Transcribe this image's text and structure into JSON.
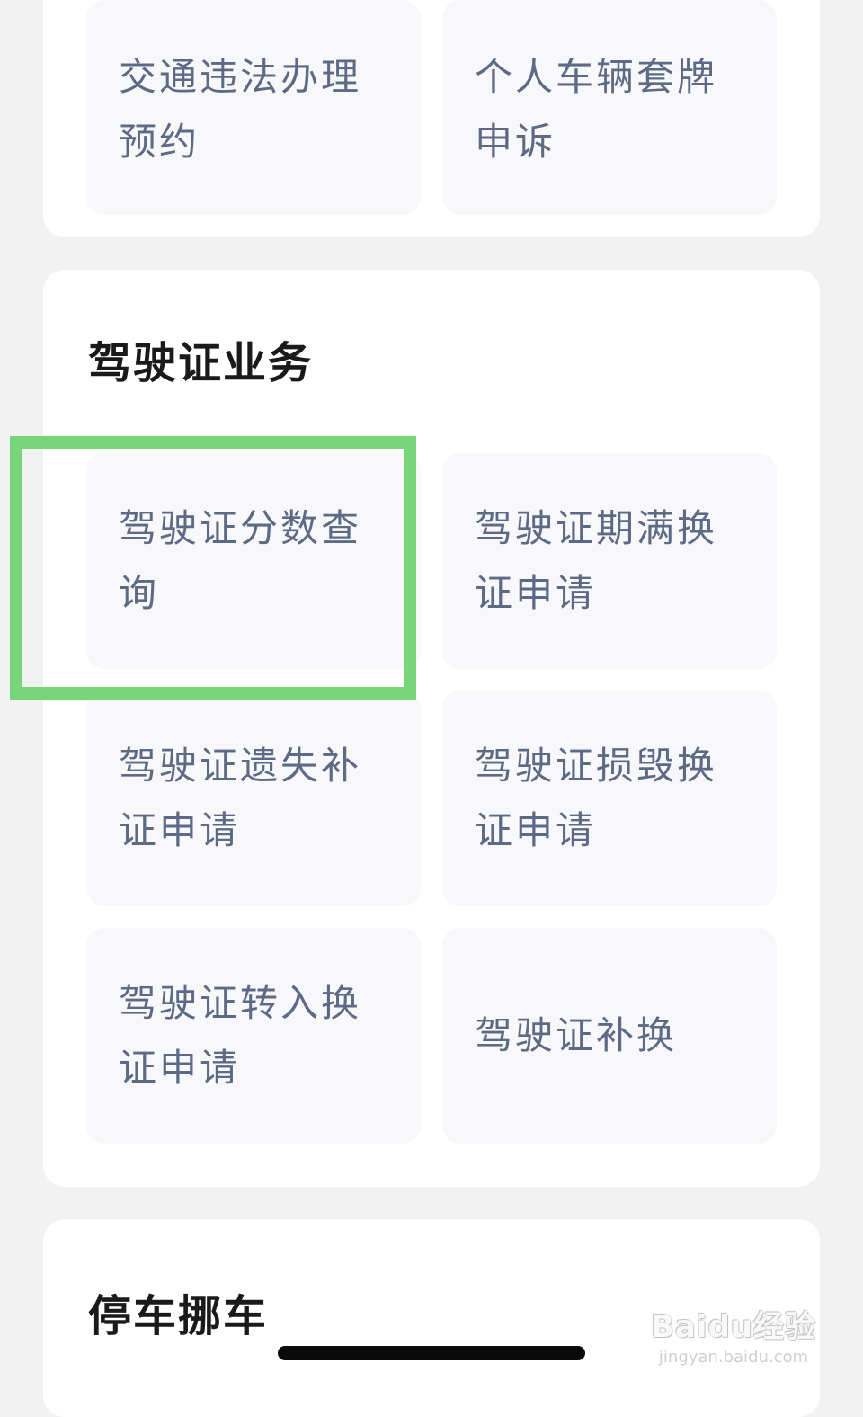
{
  "top_section": {
    "tiles": [
      {
        "label": "交通违法办理预约"
      },
      {
        "label": "个人车辆套牌申诉"
      }
    ]
  },
  "license_section": {
    "title": "驾驶证业务",
    "tiles": [
      {
        "label": "驾驶证分数查询"
      },
      {
        "label": "驾驶证期满换证申请"
      },
      {
        "label": "驾驶证遗失补证申请"
      },
      {
        "label": "驾驶证损毁换证申请"
      },
      {
        "label": "驾驶证转入换证申请"
      },
      {
        "label": "驾驶证补换"
      }
    ]
  },
  "parking_section": {
    "title": "停车挪车"
  },
  "watermark": {
    "main": "Baidu经验",
    "sub": "jingyan.baidu.com"
  },
  "colors": {
    "highlight": "#78d57a",
    "tile_text": "#5d6a86",
    "tile_bg": "#f8f8fa",
    "page_bg": "#f2f2f2"
  }
}
